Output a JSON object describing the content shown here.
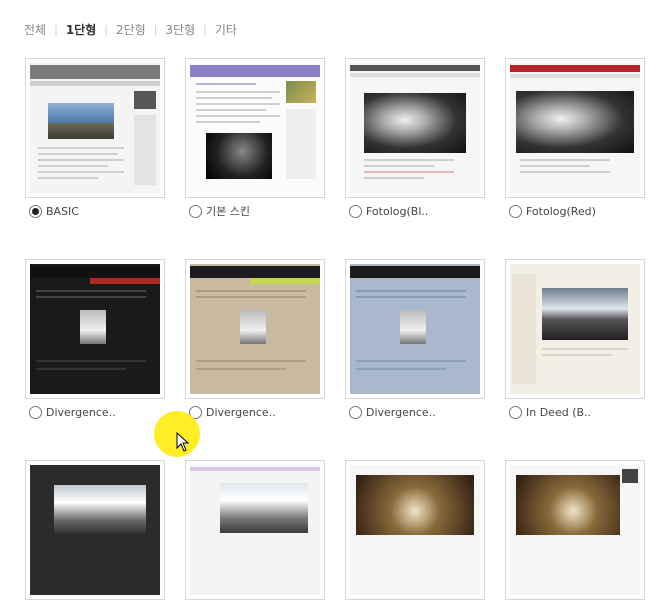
{
  "filters": {
    "tabs": [
      {
        "label": "전체",
        "active": false
      },
      {
        "label": "1단형",
        "active": true
      },
      {
        "label": "2단형",
        "active": false
      },
      {
        "label": "3단형",
        "active": false
      },
      {
        "label": "기타",
        "active": false
      }
    ]
  },
  "skins": [
    {
      "label": "BASIC",
      "selected": true
    },
    {
      "label": "기본 스킨",
      "selected": false
    },
    {
      "label": "Fotolog(Bl..",
      "selected": false
    },
    {
      "label": "Fotolog(Red)",
      "selected": false
    },
    {
      "label": "Divergence..",
      "selected": false
    },
    {
      "label": "Divergence..",
      "selected": false
    },
    {
      "label": "Divergence..",
      "selected": false
    },
    {
      "label": "In Deed (B..",
      "selected": false
    }
  ],
  "colors": {
    "accent_purple": "#8a7fc4",
    "fotolog_red": "#b5262a",
    "divergence_dark": "#1a1a1a",
    "divergence_tan": "#c8b9a0",
    "divergence_blue": "#a9b8cc",
    "highlight_yellow": "#ffeb00"
  }
}
